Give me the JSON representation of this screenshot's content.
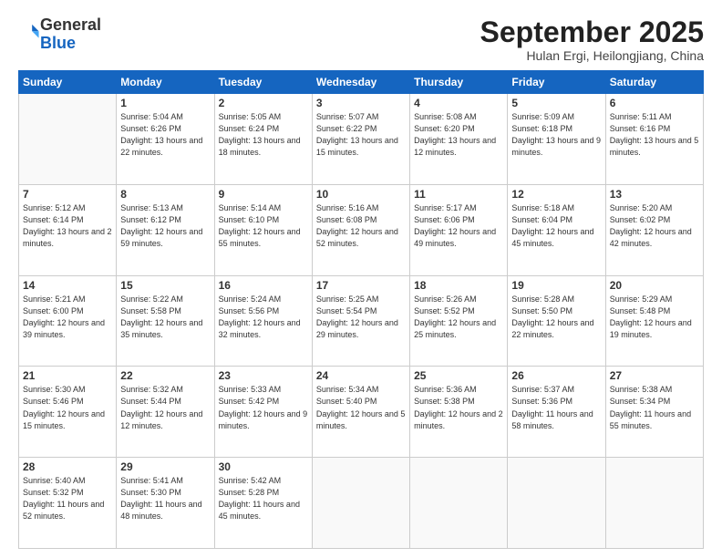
{
  "logo": {
    "general": "General",
    "blue": "Blue"
  },
  "header": {
    "month": "September 2025",
    "location": "Hulan Ergi, Heilongjiang, China"
  },
  "weekdays": [
    "Sunday",
    "Monday",
    "Tuesday",
    "Wednesday",
    "Thursday",
    "Friday",
    "Saturday"
  ],
  "weeks": [
    [
      {
        "day": "",
        "info": ""
      },
      {
        "day": "1",
        "info": "Sunrise: 5:04 AM\nSunset: 6:26 PM\nDaylight: 13 hours\nand 22 minutes."
      },
      {
        "day": "2",
        "info": "Sunrise: 5:05 AM\nSunset: 6:24 PM\nDaylight: 13 hours\nand 18 minutes."
      },
      {
        "day": "3",
        "info": "Sunrise: 5:07 AM\nSunset: 6:22 PM\nDaylight: 13 hours\nand 15 minutes."
      },
      {
        "day": "4",
        "info": "Sunrise: 5:08 AM\nSunset: 6:20 PM\nDaylight: 13 hours\nand 12 minutes."
      },
      {
        "day": "5",
        "info": "Sunrise: 5:09 AM\nSunset: 6:18 PM\nDaylight: 13 hours\nand 9 minutes."
      },
      {
        "day": "6",
        "info": "Sunrise: 5:11 AM\nSunset: 6:16 PM\nDaylight: 13 hours\nand 5 minutes."
      }
    ],
    [
      {
        "day": "7",
        "info": "Sunrise: 5:12 AM\nSunset: 6:14 PM\nDaylight: 13 hours\nand 2 minutes."
      },
      {
        "day": "8",
        "info": "Sunrise: 5:13 AM\nSunset: 6:12 PM\nDaylight: 12 hours\nand 59 minutes."
      },
      {
        "day": "9",
        "info": "Sunrise: 5:14 AM\nSunset: 6:10 PM\nDaylight: 12 hours\nand 55 minutes."
      },
      {
        "day": "10",
        "info": "Sunrise: 5:16 AM\nSunset: 6:08 PM\nDaylight: 12 hours\nand 52 minutes."
      },
      {
        "day": "11",
        "info": "Sunrise: 5:17 AM\nSunset: 6:06 PM\nDaylight: 12 hours\nand 49 minutes."
      },
      {
        "day": "12",
        "info": "Sunrise: 5:18 AM\nSunset: 6:04 PM\nDaylight: 12 hours\nand 45 minutes."
      },
      {
        "day": "13",
        "info": "Sunrise: 5:20 AM\nSunset: 6:02 PM\nDaylight: 12 hours\nand 42 minutes."
      }
    ],
    [
      {
        "day": "14",
        "info": "Sunrise: 5:21 AM\nSunset: 6:00 PM\nDaylight: 12 hours\nand 39 minutes."
      },
      {
        "day": "15",
        "info": "Sunrise: 5:22 AM\nSunset: 5:58 PM\nDaylight: 12 hours\nand 35 minutes."
      },
      {
        "day": "16",
        "info": "Sunrise: 5:24 AM\nSunset: 5:56 PM\nDaylight: 12 hours\nand 32 minutes."
      },
      {
        "day": "17",
        "info": "Sunrise: 5:25 AM\nSunset: 5:54 PM\nDaylight: 12 hours\nand 29 minutes."
      },
      {
        "day": "18",
        "info": "Sunrise: 5:26 AM\nSunset: 5:52 PM\nDaylight: 12 hours\nand 25 minutes."
      },
      {
        "day": "19",
        "info": "Sunrise: 5:28 AM\nSunset: 5:50 PM\nDaylight: 12 hours\nand 22 minutes."
      },
      {
        "day": "20",
        "info": "Sunrise: 5:29 AM\nSunset: 5:48 PM\nDaylight: 12 hours\nand 19 minutes."
      }
    ],
    [
      {
        "day": "21",
        "info": "Sunrise: 5:30 AM\nSunset: 5:46 PM\nDaylight: 12 hours\nand 15 minutes."
      },
      {
        "day": "22",
        "info": "Sunrise: 5:32 AM\nSunset: 5:44 PM\nDaylight: 12 hours\nand 12 minutes."
      },
      {
        "day": "23",
        "info": "Sunrise: 5:33 AM\nSunset: 5:42 PM\nDaylight: 12 hours\nand 9 minutes."
      },
      {
        "day": "24",
        "info": "Sunrise: 5:34 AM\nSunset: 5:40 PM\nDaylight: 12 hours\nand 5 minutes."
      },
      {
        "day": "25",
        "info": "Sunrise: 5:36 AM\nSunset: 5:38 PM\nDaylight: 12 hours\nand 2 minutes."
      },
      {
        "day": "26",
        "info": "Sunrise: 5:37 AM\nSunset: 5:36 PM\nDaylight: 11 hours\nand 58 minutes."
      },
      {
        "day": "27",
        "info": "Sunrise: 5:38 AM\nSunset: 5:34 PM\nDaylight: 11 hours\nand 55 minutes."
      }
    ],
    [
      {
        "day": "28",
        "info": "Sunrise: 5:40 AM\nSunset: 5:32 PM\nDaylight: 11 hours\nand 52 minutes."
      },
      {
        "day": "29",
        "info": "Sunrise: 5:41 AM\nSunset: 5:30 PM\nDaylight: 11 hours\nand 48 minutes."
      },
      {
        "day": "30",
        "info": "Sunrise: 5:42 AM\nSunset: 5:28 PM\nDaylight: 11 hours\nand 45 minutes."
      },
      {
        "day": "",
        "info": ""
      },
      {
        "day": "",
        "info": ""
      },
      {
        "day": "",
        "info": ""
      },
      {
        "day": "",
        "info": ""
      }
    ]
  ]
}
